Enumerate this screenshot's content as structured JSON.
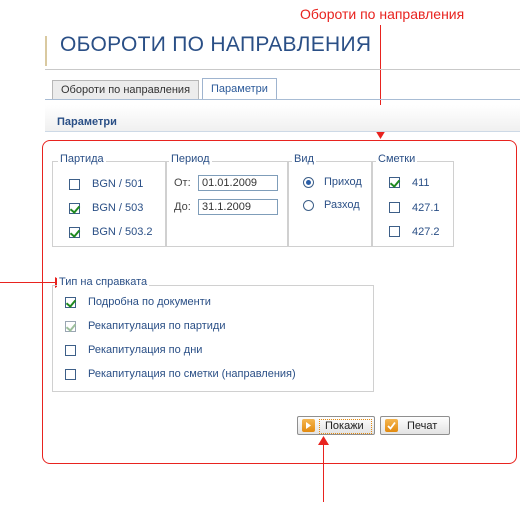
{
  "annotation": {
    "label": "Обороти по направления"
  },
  "page": {
    "title": "ОБОРОТИ ПО НАПРАВЛЕНИЯ"
  },
  "tabs": [
    {
      "label": "Обороти по направления",
      "active": false
    },
    {
      "label": "Параметри",
      "active": true
    }
  ],
  "section": {
    "title": "Параметри"
  },
  "partida": {
    "legend": "Партида",
    "items": [
      {
        "label": "BGN / 501",
        "checked": false
      },
      {
        "label": "BGN / 503",
        "checked": true
      },
      {
        "label": "BGN / 503.2",
        "checked": true
      }
    ]
  },
  "period": {
    "legend": "Период",
    "from_label": "От:",
    "from_value": "01.01.2009",
    "to_label": "До:",
    "to_value": "31.1.2009"
  },
  "vid": {
    "legend": "Вид",
    "options": [
      {
        "label": "Приход",
        "selected": true
      },
      {
        "label": "Разход",
        "selected": false
      }
    ]
  },
  "smetki": {
    "legend": "Сметки",
    "items": [
      {
        "label": "411",
        "checked": true
      },
      {
        "label": "427.1",
        "checked": false
      },
      {
        "label": "427.2",
        "checked": false
      }
    ]
  },
  "report_type": {
    "legend": "Тип на справката",
    "items": [
      {
        "label": "Подробна по документи",
        "checked": true,
        "disabled": false
      },
      {
        "label": "Рекапитулация по партиди",
        "checked": true,
        "disabled": true
      },
      {
        "label": "Рекапитулация по дни",
        "checked": false,
        "disabled": false
      },
      {
        "label": "Рекапитулация по сметки (направления)",
        "checked": false,
        "disabled": false
      }
    ]
  },
  "buttons": {
    "show": "Покажи",
    "print": "Печат"
  },
  "colors": {
    "accent": "#e8231f",
    "title": "#2a4f86",
    "check": "#1f8a1f"
  }
}
